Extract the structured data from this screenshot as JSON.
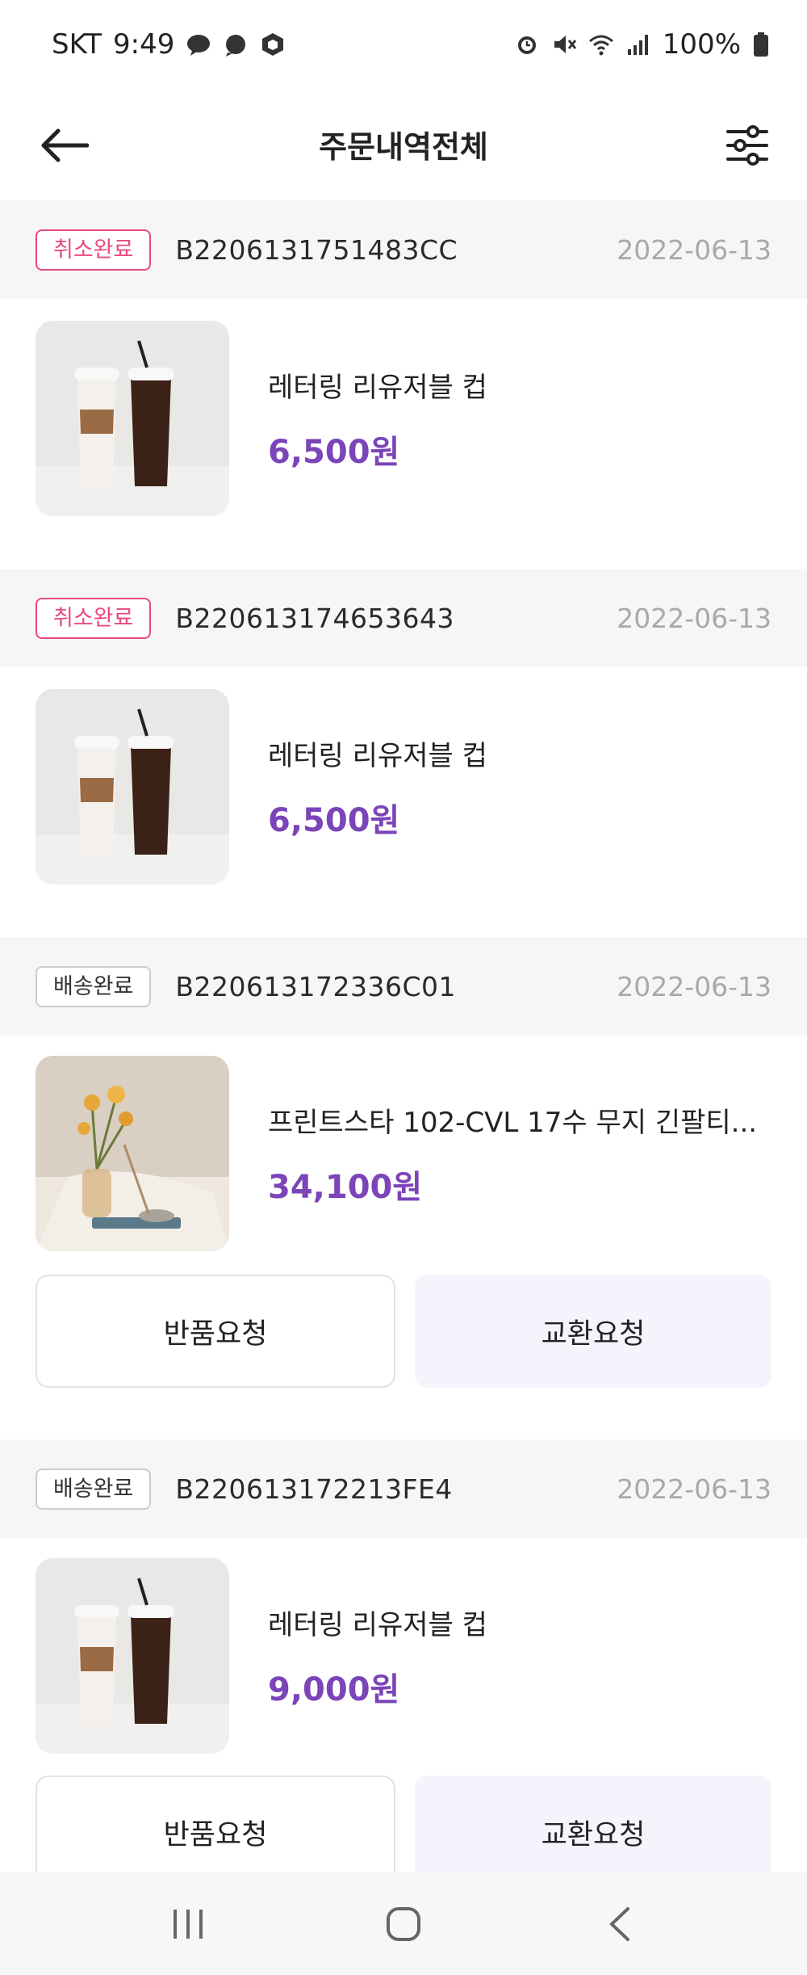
{
  "status": {
    "carrier": "SKT",
    "time": "9:49",
    "battery": "100%",
    "icons_left": [
      "talk-bubble-icon",
      "chat-bubble-icon",
      "hexagon-app-icon"
    ],
    "icons_right": [
      "alarm-icon",
      "mute-icon",
      "wifi-icon",
      "signal-icon",
      "battery-icon"
    ]
  },
  "header": {
    "title": "주문내역전체",
    "back_icon": "back-arrow-icon",
    "filter_icon": "filter-sliders-icon"
  },
  "orders": [
    {
      "status_label": "취소완료",
      "status_type": "cancel",
      "order_no": "B2206131751483CC",
      "date": "2022-06-13",
      "product_name": "레터링 리유저블 컵",
      "price": "6,500원",
      "image": "reusable-cup-photo",
      "buttons": []
    },
    {
      "status_label": "취소완료",
      "status_type": "cancel",
      "order_no": "B220613174653643",
      "date": "2022-06-13",
      "product_name": "레터링 리유저블 컵",
      "price": "6,500원",
      "image": "reusable-cup-photo",
      "buttons": []
    },
    {
      "status_label": "배송완료",
      "status_type": "delivered",
      "order_no": "B220613172336C01",
      "date": "2022-06-13",
      "product_name": "프린트스타 102-CVL 17수 무지 긴팔티...",
      "price": "34,100원",
      "image": "flower-vase-photo",
      "buttons": [
        "반품요청",
        "교환요청"
      ]
    },
    {
      "status_label": "배송완료",
      "status_type": "delivered",
      "order_no": "B220613172213FE4",
      "date": "2022-06-13",
      "product_name": "레터링 리유저블 컵",
      "price": "9,000원",
      "image": "reusable-cup-photo",
      "buttons": [
        "반품요청",
        "교환요청"
      ]
    }
  ],
  "colors": {
    "price": "#7b44b8",
    "cancel_badge": "#e84a7e",
    "exchange_bg": "#f6f3fc",
    "section_bg": "#f6f6f7"
  },
  "nav": [
    "recent-apps-icon",
    "home-icon",
    "back-icon"
  ]
}
